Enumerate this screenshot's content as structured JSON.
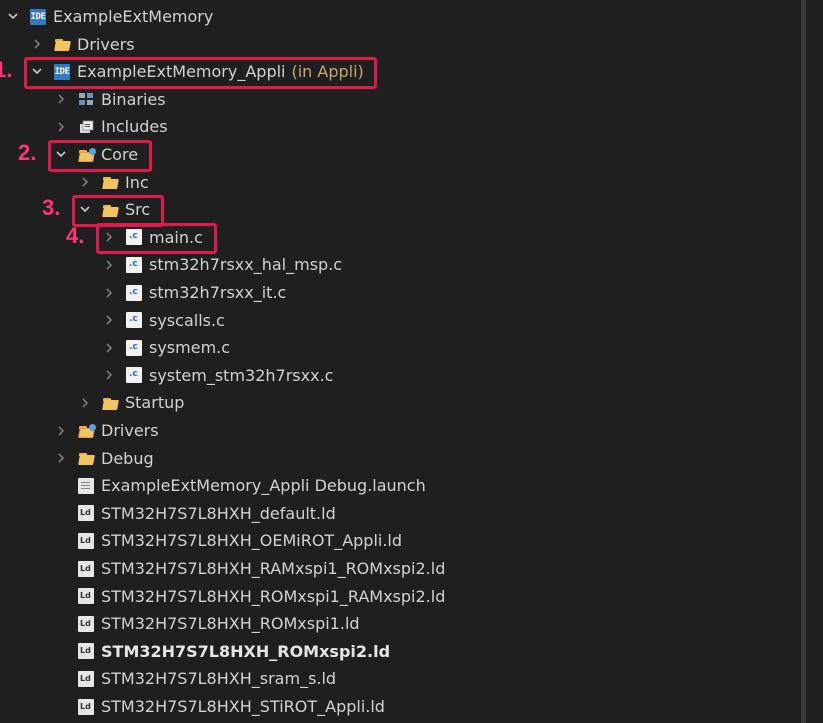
{
  "tree": [
    {
      "label": "ExampleExtMemory",
      "icon": "ide-project-icon",
      "chevron": "expanded",
      "indent": 0
    },
    {
      "label": "Drivers",
      "icon": "folder-icon",
      "chevron": "collapsed",
      "indent": 1
    },
    {
      "label": "ExampleExtMemory_Appli",
      "suffix": "(in Appli)",
      "icon": "ide-project-icon",
      "chevron": "expanded",
      "indent": 1
    },
    {
      "label": "Binaries",
      "icon": "binaries-icon",
      "chevron": "collapsed",
      "indent": 2
    },
    {
      "label": "Includes",
      "icon": "includes-icon",
      "chevron": "collapsed",
      "indent": 2
    },
    {
      "label": "Core",
      "icon": "source-folder-icon",
      "chevron": "expanded",
      "indent": 2
    },
    {
      "label": "Inc",
      "icon": "folder-icon",
      "chevron": "collapsed",
      "indent": 3
    },
    {
      "label": "Src",
      "icon": "folder-icon",
      "chevron": "expanded",
      "indent": 3
    },
    {
      "label": "main.c",
      "icon": "c-file-icon",
      "chevron": "collapsed",
      "indent": 4
    },
    {
      "label": "stm32h7rsxx_hal_msp.c",
      "icon": "c-file-icon",
      "chevron": "collapsed",
      "indent": 4
    },
    {
      "label": "stm32h7rsxx_it.c",
      "icon": "c-file-icon",
      "chevron": "collapsed",
      "indent": 4
    },
    {
      "label": "syscalls.c",
      "icon": "c-file-icon",
      "chevron": "collapsed",
      "indent": 4
    },
    {
      "label": "sysmem.c",
      "icon": "c-file-icon",
      "chevron": "collapsed",
      "indent": 4
    },
    {
      "label": "system_stm32h7rsxx.c",
      "icon": "c-file-icon",
      "chevron": "collapsed",
      "indent": 4
    },
    {
      "label": "Startup",
      "icon": "folder-icon",
      "chevron": "collapsed",
      "indent": 3
    },
    {
      "label": "Drivers",
      "icon": "source-folder-icon",
      "chevron": "collapsed",
      "indent": 2
    },
    {
      "label": "Debug",
      "icon": "folder-icon",
      "chevron": "collapsed",
      "indent": 2
    },
    {
      "label": "ExampleExtMemory_Appli Debug.launch",
      "icon": "launch-file-icon",
      "chevron": "none",
      "indent": 2
    },
    {
      "label": "STM32H7S7L8HXH_default.ld",
      "icon": "ld-file-icon",
      "chevron": "none",
      "indent": 2
    },
    {
      "label": "STM32H7S7L8HXH_OEMiROT_Appli.ld",
      "icon": "ld-file-icon",
      "chevron": "none",
      "indent": 2
    },
    {
      "label": "STM32H7S7L8HXH_RAMxspi1_ROMxspi2.ld",
      "icon": "ld-file-icon",
      "chevron": "none",
      "indent": 2
    },
    {
      "label": "STM32H7S7L8HXH_ROMxspi1_RAMxspi2.ld",
      "icon": "ld-file-icon",
      "chevron": "none",
      "indent": 2
    },
    {
      "label": "STM32H7S7L8HXH_ROMxspi1.ld",
      "icon": "ld-file-icon",
      "chevron": "none",
      "indent": 2
    },
    {
      "label": "STM32H7S7L8HXH_ROMxspi2.ld",
      "icon": "ld-file-icon",
      "chevron": "none",
      "indent": 2,
      "bold": true
    },
    {
      "label": "STM32H7S7L8HXH_sram_s.ld",
      "icon": "ld-file-icon",
      "chevron": "none",
      "indent": 2
    },
    {
      "label": "STM32H7S7L8HXH_STiROT_Appli.ld",
      "icon": "ld-file-icon",
      "chevron": "none",
      "indent": 2
    }
  ],
  "annotations": [
    {
      "number": "1.",
      "target_row": 2
    },
    {
      "number": "2.",
      "target_row": 5
    },
    {
      "number": "3.",
      "target_row": 7
    },
    {
      "number": "4.",
      "target_row": 8
    }
  ],
  "colors": {
    "annotation": "#e0194f",
    "annotation_text": "#ff3478",
    "background": "#1f1f1f",
    "suffix": "#c9a66b"
  }
}
